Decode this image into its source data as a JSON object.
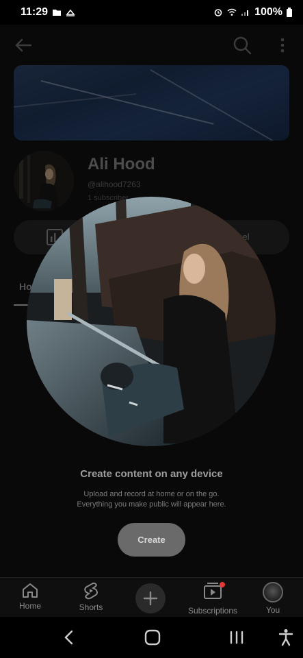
{
  "status_bar": {
    "time": "11:29",
    "battery": "100%"
  },
  "channel": {
    "name": "Ali Hood",
    "handle": "@alihood7263",
    "subscribers": "1 subscriber"
  },
  "actions": {
    "manage_label": "nnel"
  },
  "tabs": {
    "home": "Ho"
  },
  "empty_state": {
    "title": "Create content on any device",
    "line1": "Upload and record at home or on the go.",
    "line2": "Everything you make public will appear here.",
    "create_label": "Create"
  },
  "bottom_nav": {
    "home": "Home",
    "shorts": "Shorts",
    "subscriptions": "Subscriptions",
    "you": "You"
  },
  "icons": {
    "back": "arrow-left-icon",
    "search": "search-icon",
    "more": "more-vert-icon",
    "analytics": "bar-chart-icon",
    "plus": "plus-icon",
    "notification_dot_color": "#e53935"
  }
}
